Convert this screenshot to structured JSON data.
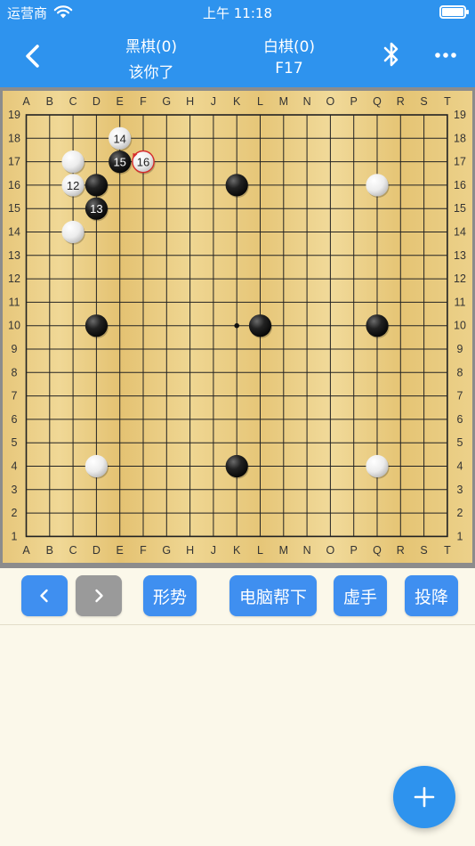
{
  "status_bar": {
    "carrier": "运营商",
    "time": "上午 11:18"
  },
  "header": {
    "black_player": {
      "name": "黑棋(0)",
      "status": "该你了"
    },
    "white_player": {
      "name": "白棋(0)",
      "status": "F17"
    }
  },
  "board": {
    "size": 19,
    "columns": [
      "A",
      "B",
      "C",
      "D",
      "E",
      "F",
      "G",
      "H",
      "J",
      "K",
      "L",
      "M",
      "N",
      "O",
      "P",
      "Q",
      "R",
      "S",
      "T"
    ],
    "rows": [
      "19",
      "18",
      "17",
      "16",
      "15",
      "14",
      "13",
      "12",
      "11",
      "10",
      "9",
      "8",
      "7",
      "6",
      "5",
      "4",
      "3",
      "2",
      "1"
    ],
    "star_points": [
      "K10"
    ],
    "stones": [
      {
        "color": "black",
        "point": "K16"
      },
      {
        "color": "black",
        "point": "D10"
      },
      {
        "color": "black",
        "point": "L10"
      },
      {
        "color": "black",
        "point": "Q10"
      },
      {
        "color": "black",
        "point": "K4"
      },
      {
        "color": "white",
        "point": "Q16"
      },
      {
        "color": "white",
        "point": "D4"
      },
      {
        "color": "white",
        "point": "Q4"
      },
      {
        "color": "white",
        "point": "C17"
      },
      {
        "color": "white",
        "point": "C14"
      },
      {
        "color": "white",
        "point": "C16",
        "label": "12"
      },
      {
        "color": "black",
        "point": "D16"
      },
      {
        "color": "black",
        "point": "D15",
        "label": "13"
      },
      {
        "color": "white",
        "point": "E18",
        "label": "14"
      },
      {
        "color": "black",
        "point": "E17",
        "label": "15"
      },
      {
        "color": "white",
        "point": "F17",
        "label": "16",
        "last_move": true
      }
    ]
  },
  "toolbar": {
    "prev_icon": "chevron-left-icon",
    "next_icon": "chevron-right-icon",
    "situation_label": "形势",
    "computer_help_label": "电脑帮下",
    "pass_label": "虚手",
    "resign_label": "投降"
  },
  "fab": {
    "icon": "plus-icon"
  },
  "colors": {
    "accent": "#2e93ee",
    "button": "#3f8ff0",
    "button_disabled": "#9a9a9a",
    "background": "#fbf8ea",
    "last_move_marker": "#d62b2b"
  }
}
